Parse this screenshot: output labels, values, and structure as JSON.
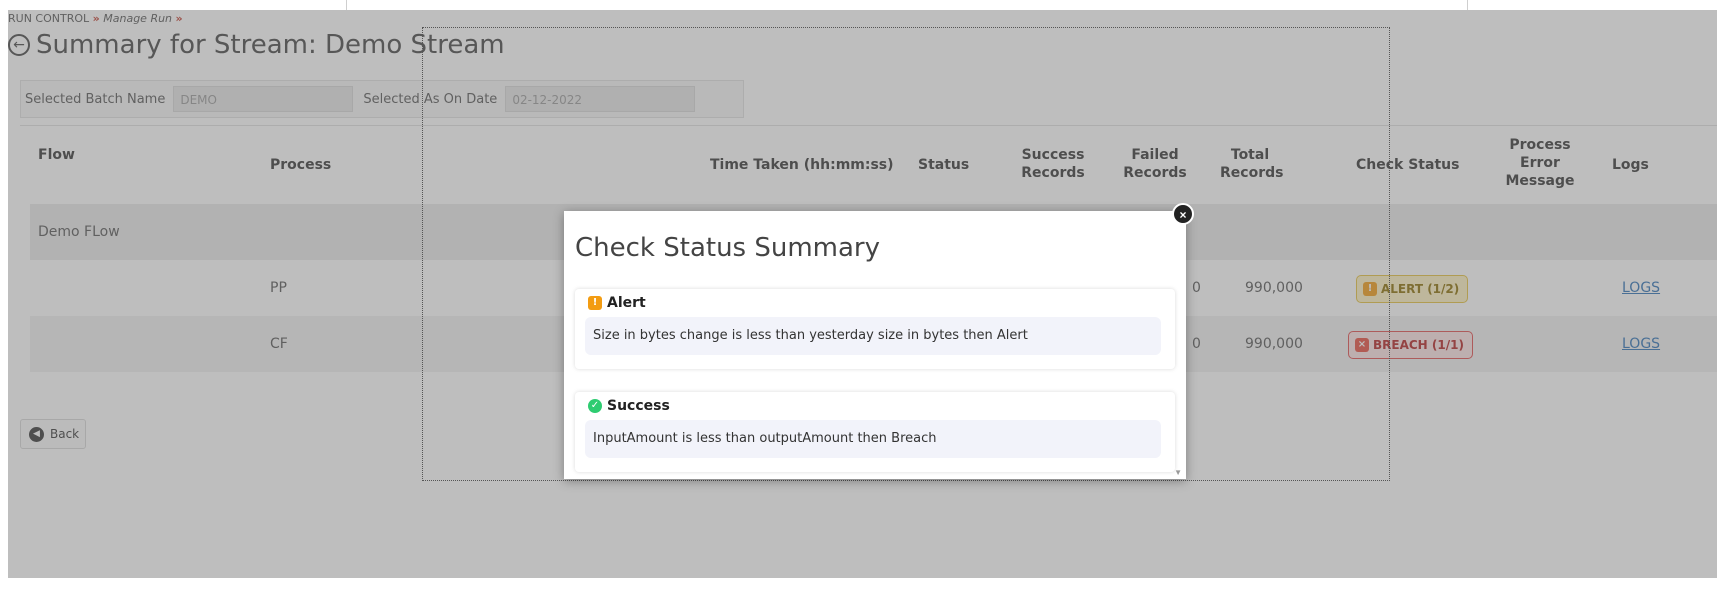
{
  "breadcrumb": {
    "root": "RUN CONTROL",
    "sep1": "»",
    "sub": "Manage Run",
    "sep2": "»"
  },
  "page": {
    "title": "Summary for Stream: Demo Stream",
    "back_arrow_icon": "circle-arrow-left-icon"
  },
  "filters": {
    "batch_label": "Selected Batch Name",
    "batch_value": "DEMO",
    "date_label": "Selected As On Date",
    "date_value": "02-12-2022"
  },
  "table": {
    "headers": {
      "flow": "Flow",
      "process": "Process",
      "time_taken": "Time Taken (hh:mm:ss)",
      "status": "Status",
      "success_records": "Success Records",
      "failed_records": "Failed Records",
      "total_records": "Total Records",
      "check_status": "Check Status",
      "process_error": "Process Error Message",
      "logs": "Logs"
    },
    "flow_row": {
      "flow": "Demo FLow"
    },
    "rows": [
      {
        "process": "PP",
        "failed_records_partial": "0",
        "total_records": "990,000",
        "check_status": "ALERT (1/2)",
        "logs": "LOGS"
      },
      {
        "process": "CF",
        "failed_records_partial": "0",
        "total_records": "990,000",
        "check_status": "BREACH (1/1)",
        "logs": "LOGS"
      }
    ]
  },
  "back_button": {
    "label": "Back"
  },
  "modal": {
    "title": "Check Status Summary",
    "close_glyph": "×",
    "cards": [
      {
        "heading": "Alert",
        "icon": "warning-icon",
        "text": "Size in bytes change is less than yesterday size in bytes then Alert"
      },
      {
        "heading": "Success",
        "icon": "check-circle-icon",
        "text": "InputAmount is less than outputAmount then Breach"
      }
    ]
  },
  "colors": {
    "alert": "#f39c12",
    "breach": "#e74c3c",
    "success": "#2ecc71",
    "link": "#2a6fb5",
    "breadcrumb_separator": "#c0392b"
  }
}
